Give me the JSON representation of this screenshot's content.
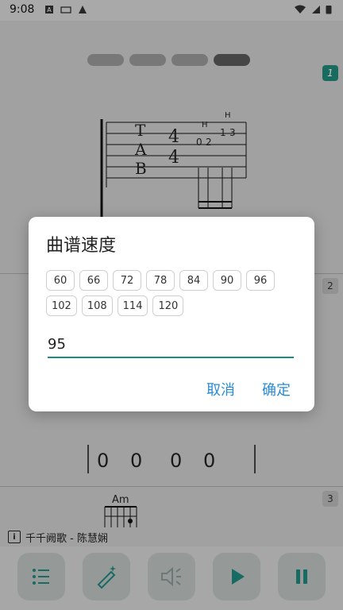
{
  "status": {
    "time": "9:08"
  },
  "sheet": {
    "measures": [
      "1",
      "2",
      "3"
    ],
    "tab_letters": [
      "T",
      "A",
      "B"
    ],
    "time_sig": [
      "4",
      "4"
    ],
    "fret_marks": [
      "0",
      "2",
      "1",
      "3"
    ],
    "hammer_labels": [
      "H",
      "H"
    ],
    "beats": [
      "0",
      "0",
      "0",
      "0"
    ],
    "chord": "Am"
  },
  "song": {
    "title": "千千阙歌 - 陈慧娴"
  },
  "dialog": {
    "title": "曲谱速度",
    "presets": [
      "60",
      "66",
      "72",
      "78",
      "84",
      "90",
      "96",
      "102",
      "108",
      "114",
      "120"
    ],
    "input_value": "95",
    "cancel_label": "取消",
    "confirm_label": "确定"
  },
  "toolbar": {
    "buttons": [
      "list-icon",
      "magic-wand-icon",
      "speaker-icon",
      "play-icon",
      "pause-icon"
    ]
  },
  "colors": {
    "accent": "#1f8a7e",
    "button_text": "#2a8bd4"
  }
}
